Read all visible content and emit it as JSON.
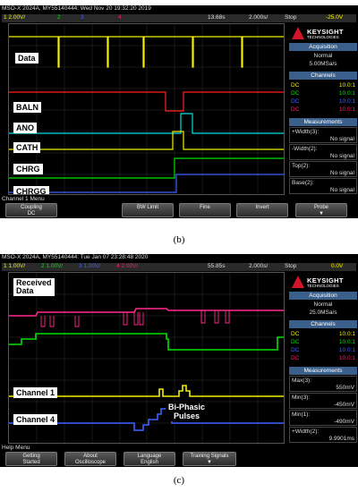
{
  "captions": {
    "b": "(b)",
    "c": "(c)"
  },
  "scope_b": {
    "title": "MSO-X 2024A, MY55140444: Wed Nov 20 19:32:20 2019",
    "ch1": "1  2.00V/",
    "ch2": "2",
    "ch3": "3",
    "ch4": "4",
    "delay": "13.68s",
    "timebase": "2.000s/",
    "run": "Stop",
    "trig": "-25.0V",
    "brand": "KEYSIGHT",
    "brand_sub": "TECHNOLOGIES",
    "acq_header": "Acquisition",
    "acq_mode": "Normal",
    "acq_rate": "5.00MSa/s",
    "channels_header": "Channels",
    "dc_rows": [
      {
        "coupling": "DC",
        "ratio": "10.0:1",
        "color": "#f0f000"
      },
      {
        "coupling": "DC",
        "ratio": "10.0:1",
        "color": "#00e000"
      },
      {
        "coupling": "DC",
        "ratio": "10.0:1",
        "color": "#4060ff"
      },
      {
        "coupling": "DC",
        "ratio": "10.0:1",
        "color": "#ff2060"
      }
    ],
    "meas_header": "Measurements",
    "measurements": [
      {
        "label": "+Width(3):",
        "value": "No signal"
      },
      {
        "label": "-Width(2):",
        "value": "No signal"
      },
      {
        "label": "Top(2):",
        "value": "No signal"
      },
      {
        "label": "Base(2):",
        "value": "No signal"
      }
    ],
    "labels": {
      "data": "Data",
      "baln": "BALN",
      "ano": "ANO",
      "cath": "CATH",
      "chrg": "CHRG",
      "chrgg": "CHRGG"
    },
    "menu_title": "Channel 1 Menu",
    "buttons": [
      {
        "line1": "Coupling",
        "line2": "DC"
      },
      {
        "line1": "BW Limit",
        "line2": ""
      },
      {
        "line1": "Fine",
        "line2": ""
      },
      {
        "line1": "Invert",
        "line2": ""
      },
      {
        "line1": "Probe",
        "line2": "▼"
      }
    ]
  },
  "scope_c": {
    "title": "MSO-X 2024A, MY55140444: Tue Jan 07 23:28:48 2020",
    "ch1": "1  1.00V/",
    "ch2": "2  1.00V/",
    "ch3": "3  1.00V/",
    "ch4": "4  2.00V/",
    "delay": "55.85s",
    "timebase": "2.000s/",
    "run": "Stop",
    "trig": "0.0V",
    "brand": "KEYSIGHT",
    "brand_sub": "TECHNOLOGIES",
    "acq_header": "Acquisition",
    "acq_mode": "Normal",
    "acq_rate": "25.0MSa/s",
    "channels_header": "Channels",
    "dc_rows": [
      {
        "coupling": "DC",
        "ratio": "10.0:1",
        "color": "#f0f000"
      },
      {
        "coupling": "DC",
        "ratio": "10.0:1",
        "color": "#00e000"
      },
      {
        "coupling": "DC",
        "ratio": "10.0:1",
        "color": "#4060ff"
      },
      {
        "coupling": "DC",
        "ratio": "10.0:1",
        "color": "#ff2060"
      }
    ],
    "meas_header": "Measurements",
    "measurements": [
      {
        "label": "Max(3):",
        "value": "550mV"
      },
      {
        "label": "Min(3):",
        "value": "-450mV"
      },
      {
        "label": "Min(1):",
        "value": "-490mV"
      },
      {
        "label": "+Width(2):",
        "value": "9.9901ms"
      }
    ],
    "labels": {
      "received1": "Received",
      "received2": "Data",
      "channel1": "Channel 1",
      "channel4": "Channel 4",
      "biphasic1": "Bi-Phasic",
      "biphasic2": "Pulses"
    },
    "menu_title": "Help Menu",
    "buttons": [
      {
        "line1": "Getting",
        "line2": "Started"
      },
      {
        "line1": "About",
        "line2": "Oscilloscope"
      },
      {
        "line1": "Language",
        "line2": "English"
      },
      {
        "line1": "Training Signals",
        "line2": "▼"
      }
    ]
  }
}
